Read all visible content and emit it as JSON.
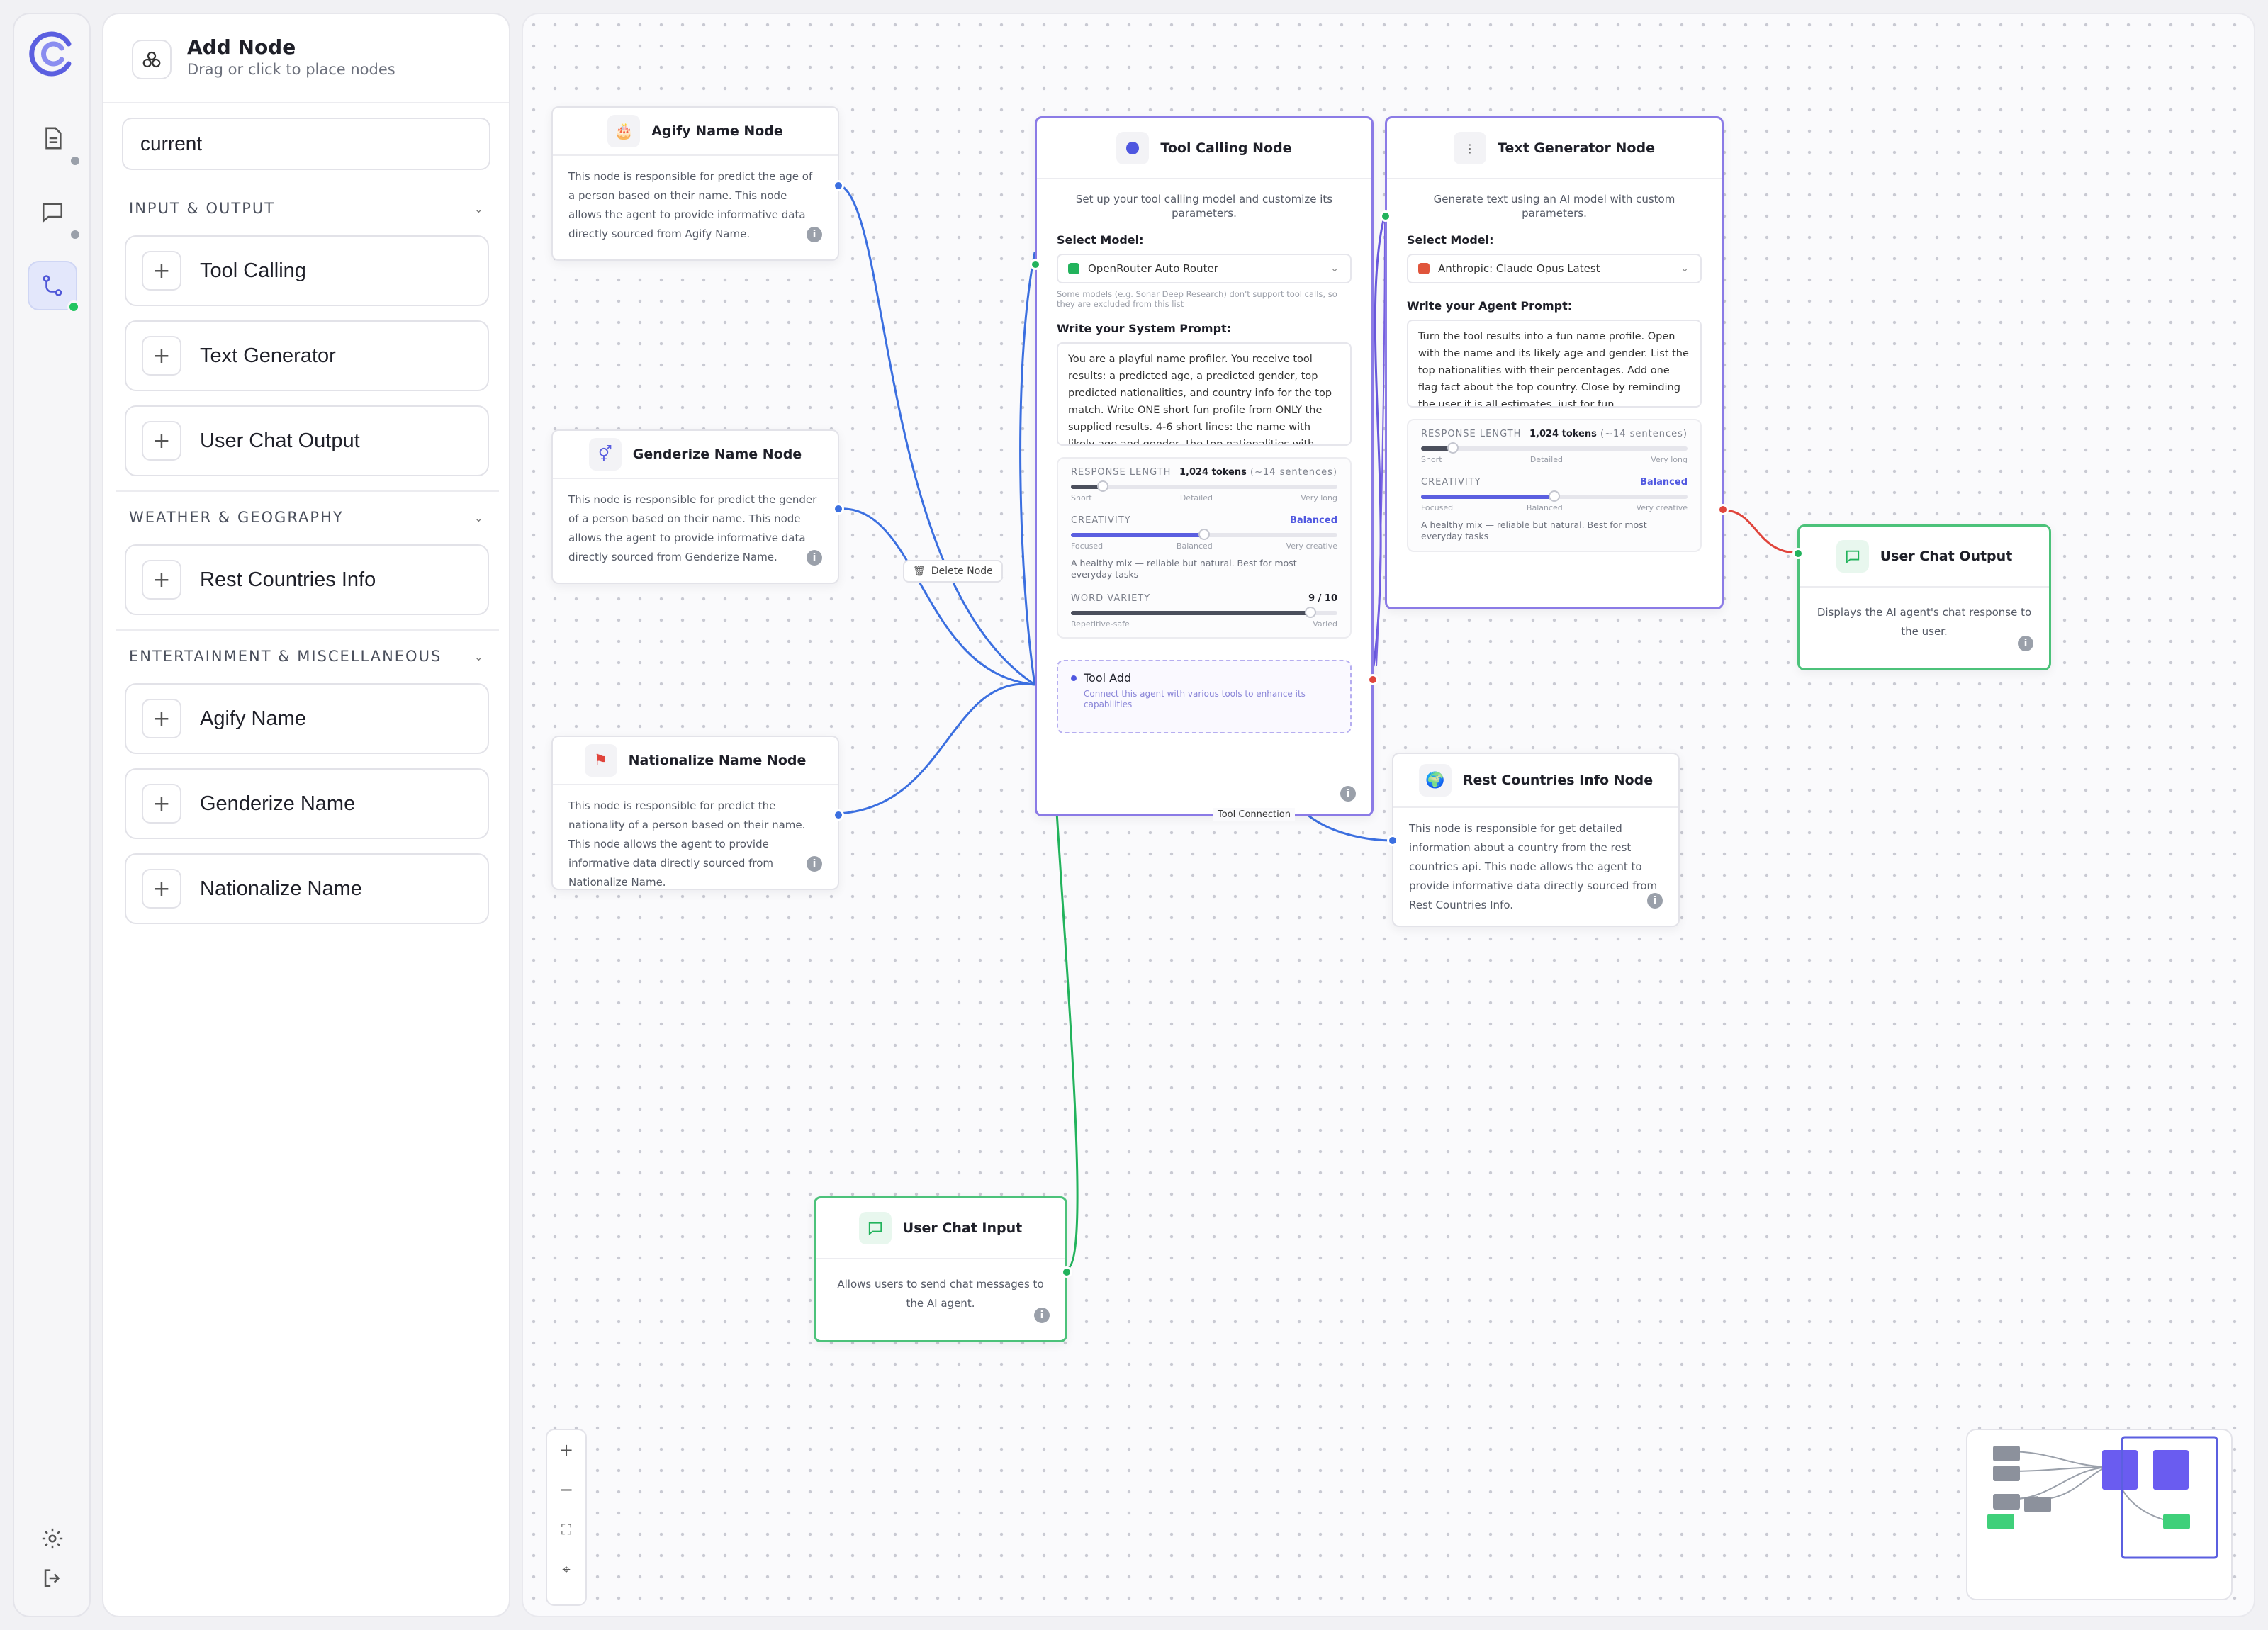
{
  "sidebar_rail": {
    "items": [
      {
        "name": "document-icon"
      },
      {
        "name": "chat-icon"
      },
      {
        "name": "flow-icon"
      }
    ],
    "bottom": [
      "settings-icon",
      "logout-icon"
    ]
  },
  "panel": {
    "title": "Add Node",
    "subtitle": "Drag or click to place nodes",
    "search_value": "current",
    "sections": [
      {
        "label": "INPUT & OUTPUT",
        "items": [
          "Tool Calling",
          "Text Generator",
          "User Chat Output"
        ]
      },
      {
        "label": "WEATHER & GEOGRAPHY",
        "items": [
          "Rest Countries Info"
        ]
      },
      {
        "label": "ENTERTAINMENT & MISCELLANEOUS",
        "items": [
          "Agify Name",
          "Genderize Name",
          "Nationalize Name"
        ]
      }
    ]
  },
  "nodes": {
    "agify": {
      "icon": "cake-icon",
      "title": "Agify Name Node",
      "desc": "This node is responsible for predict the age of a person based on their name. This node allows the agent to provide informative data directly sourced from Agify Name."
    },
    "genderize": {
      "icon": "gender-icon",
      "title": "Genderize Name Node",
      "desc": "This node is responsible for predict the gender of a person based on their name. This node allows the agent to provide informative data directly sourced from Genderize Name."
    },
    "nationalize": {
      "icon": "flag-icon",
      "title": "Nationalize Name Node",
      "desc": "This node is responsible for predict the nationality of a person based on their name. This node allows the agent to provide informative data directly sourced from Nationalize Name."
    },
    "tool_calling": {
      "title": "Tool Calling Node",
      "desc": "Set up your tool calling model and customize its parameters.",
      "model_label": "Select Model:",
      "model_value": "OpenRouter Auto Router",
      "model_note": "Some models (e.g. Sonar Deep Research) don't support tool calls, so they are excluded from this list",
      "prompt_label": "Write your System Prompt:",
      "prompt": "You are a playful name profiler. You receive tool results: a predicted age, a predicted gender, top predicted nationalities, and country info for the top match. Write ONE short fun profile from ONLY the supplied results. 4-6 short lines: the name with likely age and gender, the top nationalities with percentages, and one fact about the",
      "response_length_label": "RESPONSE LENGTH",
      "response_length_value": "1,024 tokens",
      "response_length_hint": "(~14 sentences)",
      "rl_ticks": [
        "Short",
        "Detailed",
        "Very long"
      ],
      "rl_level": 0.12,
      "creativity_label": "CREATIVITY",
      "creativity_value": "Balanced",
      "cr_ticks": [
        "Focused",
        "Balanced",
        "Very creative"
      ],
      "cr_level": 0.5,
      "creativity_note": "A healthy mix — reliable but natural. Best for most everyday tasks",
      "word_variety_label": "WORD VARIETY",
      "word_variety_value": "9 / 10",
      "wv_ticks": [
        "Repetitive-safe",
        "Varied"
      ],
      "wv_level": 0.9,
      "tool_add_title": "Tool Add",
      "tool_add_desc": "Connect this agent with various tools to enhance its capabilities"
    },
    "text_generator": {
      "title": "Text Generator Node",
      "desc": "Generate text using an AI model with custom parameters.",
      "model_label": "Select Model:",
      "model_value": "Anthropic: Claude Opus Latest",
      "prompt_label": "Write your Agent Prompt:",
      "prompt": "Turn the tool results into a fun name profile. Open with the name and its likely age and gender. List the top nationalities with their percentages. Add one flag fact about the top country. Close by reminding the user it is all estimates, just for fun.",
      "response_length_label": "RESPONSE LENGTH",
      "response_length_value": "1,024 tokens",
      "response_length_hint": "(~14 sentences)",
      "rl_ticks": [
        "Short",
        "Detailed",
        "Very long"
      ],
      "rl_level": 0.12,
      "creativity_label": "CREATIVITY",
      "creativity_value": "Balanced",
      "cr_ticks": [
        "Focused",
        "Balanced",
        "Very creative"
      ],
      "cr_level": 0.5,
      "creativity_note": "A healthy mix — reliable but natural. Best for most everyday tasks"
    },
    "user_chat_output": {
      "title": "User Chat Output",
      "desc": "Displays the AI agent's chat response to the user."
    },
    "rest_countries": {
      "title": "Rest Countries Info Node",
      "desc": "This node is responsible for get detailed information about a country from the rest countries api. This node allows the agent to provide informative data directly sourced from Rest Countries Info."
    },
    "user_chat_input": {
      "title": "User Chat Input",
      "desc": "Allows users to send chat messages to the AI agent."
    }
  },
  "canvas": {
    "delete_node_label": "Delete Node",
    "tool_connection_label": "Tool Connection",
    "zoom_controls": [
      "+",
      "−",
      "⛶",
      "⌖"
    ]
  },
  "colors": {
    "accent": "#5b5fe0",
    "tool_border": "#8b7be6",
    "green": "#22b35c",
    "blue_edge": "#3b6fe0",
    "red_edge": "#e0443b"
  }
}
